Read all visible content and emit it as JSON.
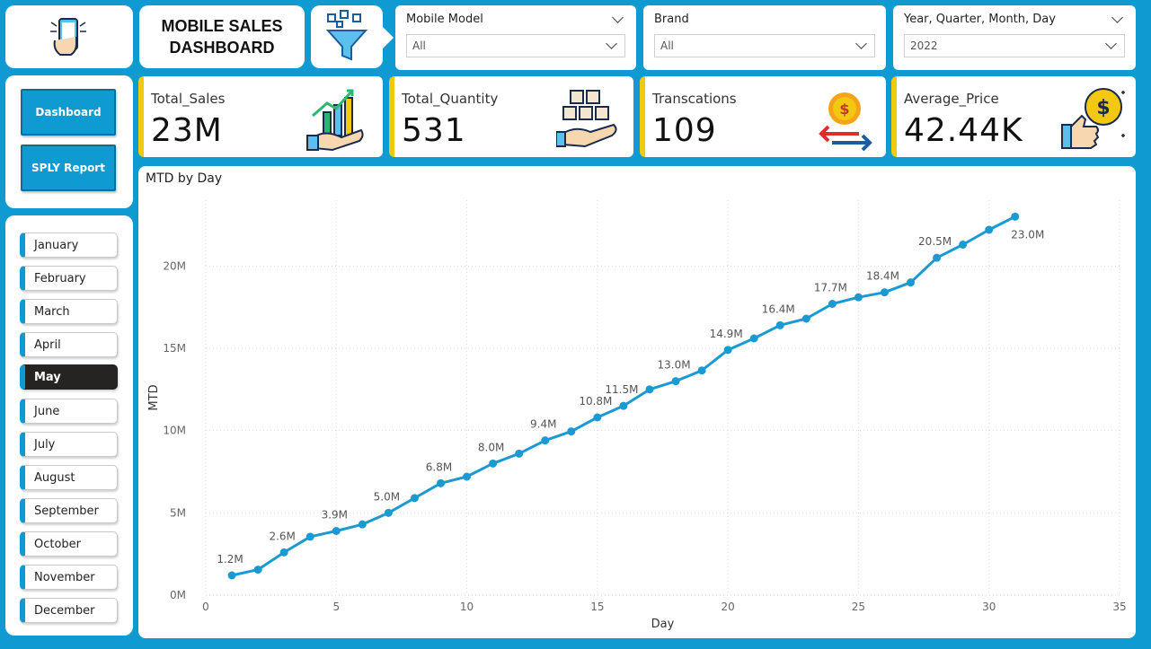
{
  "header": {
    "title_line1": "MOBILE SALES",
    "title_line2": "DASHBOARD"
  },
  "slicers": [
    {
      "label": "Mobile Model",
      "value": "All"
    },
    {
      "label": "Brand",
      "value": "All"
    },
    {
      "label": "Year, Quarter, Month, Day",
      "value": "2022"
    }
  ],
  "nav": {
    "dashboard": "Dashboard",
    "sply": "SPLY Report"
  },
  "months": [
    "January",
    "February",
    "March",
    "April",
    "May",
    "June",
    "July",
    "August",
    "September",
    "October",
    "November",
    "December"
  ],
  "selected_month": "May",
  "kpis": [
    {
      "label": "Total_Sales",
      "value": "23M",
      "icon": "sales-growth-icon"
    },
    {
      "label": "Total_Quantity",
      "value": "531",
      "icon": "boxes-hand-icon"
    },
    {
      "label": "Transcations",
      "value": "109",
      "icon": "coin-exchange-icon"
    },
    {
      "label": "Average_Price",
      "value": "42.44K",
      "icon": "thumbs-up-dollar-icon"
    }
  ],
  "colors": {
    "background": "#0f9bd1",
    "accent": "#f2c811",
    "line": "#1a9ad1",
    "selected": "#252423"
  },
  "chart_data": {
    "type": "line",
    "title": "MTD by Day",
    "xlabel": "Day",
    "ylabel": "MTD",
    "xlim": [
      0,
      35
    ],
    "ylim": [
      0,
      24
    ],
    "x_ticks": [
      0,
      5,
      10,
      15,
      20,
      25,
      30,
      35
    ],
    "y_ticks": [
      {
        "value": 0,
        "label": "0M"
      },
      {
        "value": 5,
        "label": "5M"
      },
      {
        "value": 10,
        "label": "10M"
      },
      {
        "value": 15,
        "label": "15M"
      },
      {
        "value": 20,
        "label": "20M"
      }
    ],
    "grid": true,
    "series": [
      {
        "x": [
          1,
          2,
          3,
          4,
          5,
          6,
          7,
          8,
          9,
          10,
          11,
          12,
          13,
          14,
          15,
          16,
          17,
          18,
          19,
          20,
          21,
          22,
          23,
          24,
          25,
          26,
          27,
          28,
          29,
          30,
          31
        ],
        "values": [
          1.2,
          1.55,
          2.6,
          3.55,
          3.9,
          4.3,
          5.0,
          5.9,
          6.8,
          7.2,
          8.0,
          8.6,
          9.4,
          9.95,
          10.8,
          11.5,
          12.5,
          13.0,
          13.65,
          14.9,
          15.6,
          16.4,
          16.8,
          17.7,
          18.1,
          18.4,
          19.0,
          20.5,
          21.3,
          22.2,
          23.0
        ]
      }
    ],
    "data_labels": [
      {
        "x": 1,
        "text": "1.2M"
      },
      {
        "x": 3,
        "text": "2.6M"
      },
      {
        "x": 5,
        "text": "3.9M"
      },
      {
        "x": 7,
        "text": "5.0M"
      },
      {
        "x": 9,
        "text": "6.8M"
      },
      {
        "x": 11,
        "text": "8.0M"
      },
      {
        "x": 13,
        "text": "9.4M"
      },
      {
        "x": 15,
        "text": "10.8M"
      },
      {
        "x": 16,
        "text": "11.5M"
      },
      {
        "x": 18,
        "text": "13.0M"
      },
      {
        "x": 20,
        "text": "14.9M"
      },
      {
        "x": 22,
        "text": "16.4M"
      },
      {
        "x": 24,
        "text": "17.7M"
      },
      {
        "x": 26,
        "text": "18.4M"
      },
      {
        "x": 28,
        "text": "20.5M"
      },
      {
        "x": 31,
        "text": "23.0M",
        "below": true
      }
    ]
  }
}
